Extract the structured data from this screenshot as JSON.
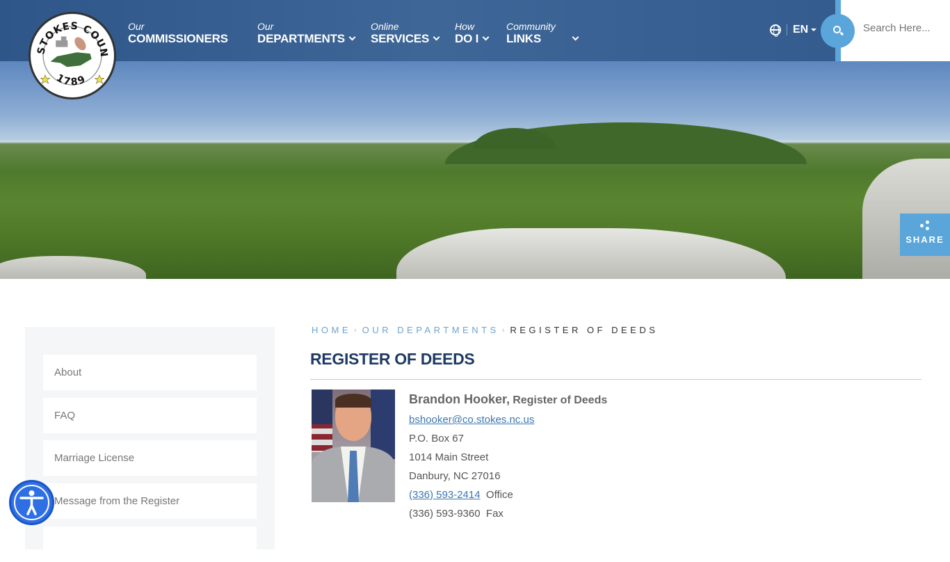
{
  "logo": {
    "top_text": "STOKES COUNTY",
    "year": "1789"
  },
  "nav": {
    "items": [
      {
        "small": "Our",
        "big": "COMMISSIONERS",
        "has_dropdown": false
      },
      {
        "small": "Our",
        "big": "DEPARTMENTS",
        "has_dropdown": true
      },
      {
        "small": "Online",
        "big": "SERVICES",
        "has_dropdown": true
      },
      {
        "small": "How",
        "big": "DO I",
        "has_dropdown": true
      },
      {
        "small": "Community",
        "big": "LINKS",
        "has_dropdown": true
      }
    ],
    "language": "EN",
    "search_placeholder": "Search Here..."
  },
  "share": {
    "label": "SHARE"
  },
  "sidebar": {
    "items": [
      {
        "label": "About"
      },
      {
        "label": "FAQ"
      },
      {
        "label": "Marriage License"
      },
      {
        "label": "Message from the Register"
      }
    ]
  },
  "breadcrumb": {
    "items": [
      {
        "label": "HOME"
      },
      {
        "label": "OUR DEPARTMENTS"
      },
      {
        "label": "REGISTER OF DEEDS"
      }
    ]
  },
  "page": {
    "title": "REGISTER OF DEEDS",
    "contact": {
      "name": "Brandon Hooker,",
      "role": "Register of Deeds",
      "email": "bshooker@co.stokes.nc.us",
      "po_box": "P.O. Box 67",
      "street": "1014 Main Street",
      "city": "Danbury, NC 27016",
      "phone": "(336) 593-2414",
      "phone_label": "Office",
      "fax": "(336) 593-9360",
      "fax_label": "Fax"
    }
  },
  "colors": {
    "header": "#2f5689",
    "accent": "#5aa6da",
    "title": "#1e3a64",
    "link": "#3b77b0"
  }
}
